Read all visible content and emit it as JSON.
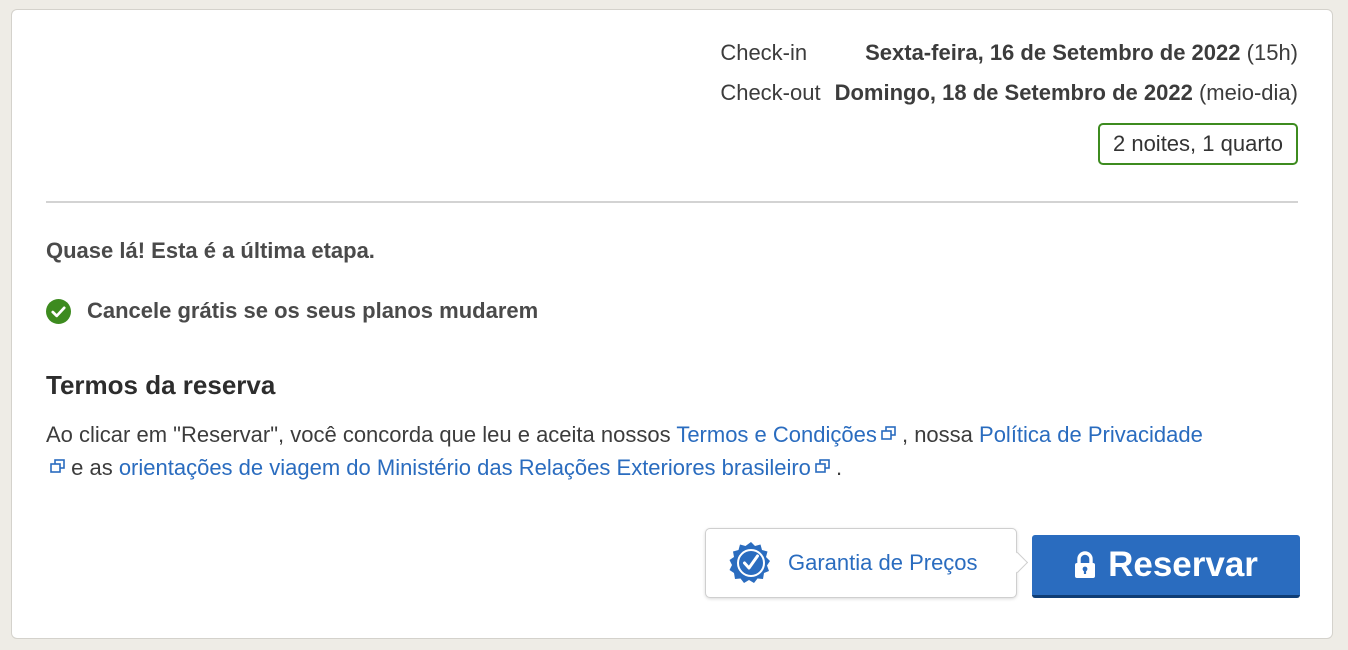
{
  "stay": {
    "checkin_label": "Check-in",
    "checkin_date": "Sexta-feira, 16 de Setembro de 2022",
    "checkin_time": "(15h)",
    "checkout_label": "Check-out",
    "checkout_date": "Domingo, 18 de Setembro de 2022",
    "checkout_time": "(meio-dia)",
    "nights": "2 noites, 1 quarto"
  },
  "messages": {
    "almost": "Quase lá! Esta é a última etapa.",
    "free_cancel": "Cancele grátis se os seus planos mudarem"
  },
  "terms": {
    "title": "Termos da reserva",
    "text_1": "Ao clicar em \"Reservar\", você concorda que leu e aceita nossos ",
    "link_terms": "Termos e Condições",
    "text_2": " , nossa ",
    "link_privacy": "Política de Privacidade",
    "text_3": " e as ",
    "link_travel": "orientações de viagem do Ministério das Relações Exteriores brasileiro",
    "text_4": " ."
  },
  "actions": {
    "guarantee_label": "Garantia de Preços",
    "reserve_label": "Reservar"
  },
  "colors": {
    "link": "#2a6cbf",
    "success": "#3d8b1f",
    "button": "#2a6cbf"
  },
  "icons": {
    "check": "check-circle-icon",
    "external": "external-link-icon",
    "seal": "guarantee-seal-icon",
    "lock": "lock-icon"
  }
}
